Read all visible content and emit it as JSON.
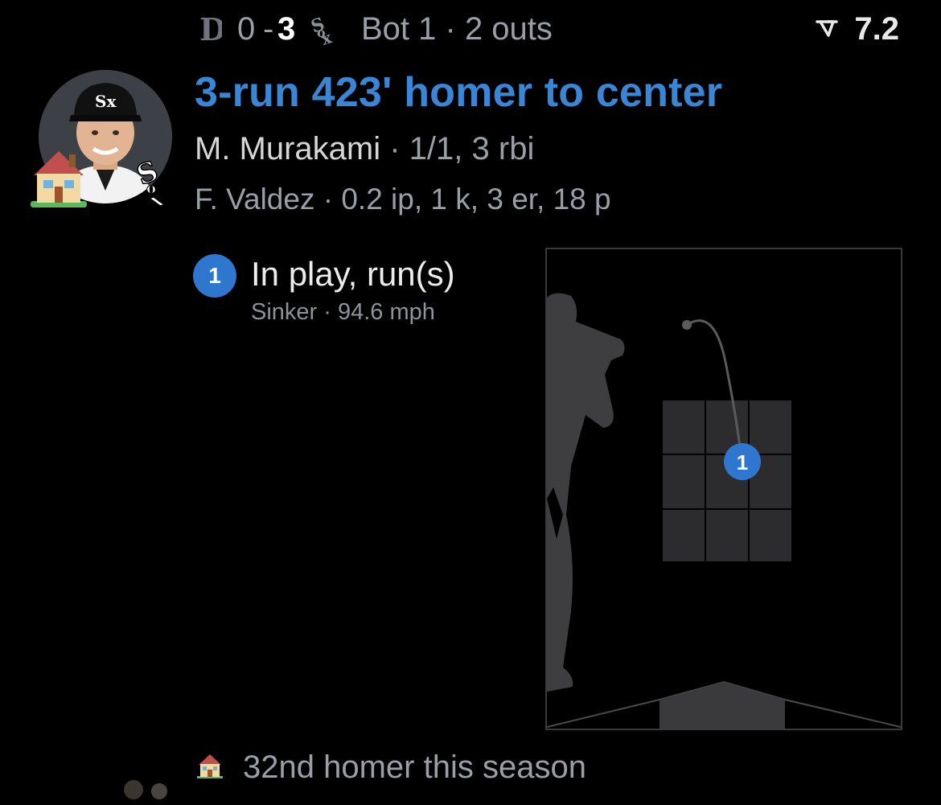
{
  "header": {
    "away_team_icon": "tigers-logo-icon",
    "away_score": "0",
    "separator": "-",
    "home_score": "3",
    "home_team_icon": "white-sox-logo-icon",
    "inning_status": "Bot 1 · 2 outs",
    "win_prob_icon": "win-probability-icon",
    "win_prob_value": "7.2"
  },
  "play": {
    "avatar_icon": "player-headshot",
    "badge_icon": "house-icon",
    "team_badge_icon": "white-sox-logo-icon",
    "headline": "3-run 423' homer to center",
    "batter_name": "M. Murakami",
    "batter_stats": "1/1, 3 rbi",
    "pitcher_name": "F. Valdez",
    "pitcher_stats": "0.2 ip, 1 k, 3 er, 18 p"
  },
  "pitch": {
    "number": "1",
    "result": "In play, run(s)",
    "type_speed": "Sinker · 94.6 mph",
    "zone_marker_label": "1",
    "zone_cell": "middle-middle"
  },
  "footer": {
    "icon": "house-icon",
    "text": "32nd homer this season"
  },
  "colors": {
    "accent_blue": "#3a86d6",
    "badge_blue": "#2f76cf",
    "muted_text": "#9a9ea6",
    "zone_cell": "#2c2c2e"
  }
}
